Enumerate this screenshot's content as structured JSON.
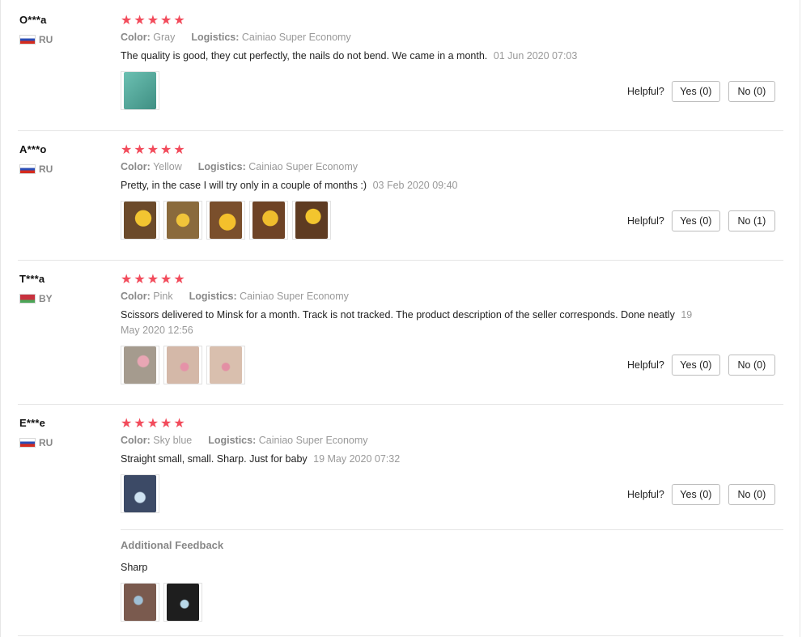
{
  "reviews": [
    {
      "user": "O***a",
      "country": "RU",
      "flag": "ru",
      "color_label": "Color:",
      "color_value": "Gray",
      "logistics_label": "Logistics:",
      "logistics_value": "Cainiao Super Economy",
      "text": "The quality is good, they cut perfectly, the nails do not bend. We came in a month.",
      "date": "01 Jun 2020 07:03",
      "helpful_label": "Helpful?",
      "yes_label": "Yes (0)",
      "no_label": "No (0)",
      "photos": [
        "#4fa79b"
      ]
    },
    {
      "user": "A***o",
      "country": "RU",
      "flag": "ru",
      "color_label": "Color:",
      "color_value": "Yellow",
      "logistics_label": "Logistics:",
      "logistics_value": "Cainiao Super Economy",
      "text": "Pretty, in the case I will try only in a couple of months :)",
      "date": "03 Feb 2020 09:40",
      "helpful_label": "Helpful?",
      "yes_label": "Yes (0)",
      "no_label": "No (1)",
      "photos": [
        "#6b4a2a",
        "#8a6a3c",
        "#7a4f2c",
        "#6e4326",
        "#5e3b22"
      ]
    },
    {
      "user": "T***a",
      "country": "BY",
      "flag": "by",
      "color_label": "Color:",
      "color_value": "Pink",
      "logistics_label": "Logistics:",
      "logistics_value": "Cainiao Super Economy",
      "text": "Scissors delivered to Minsk for a month. Track is not tracked. The product description of the seller corresponds. Done neatly",
      "date": "19 May 2020 12:56",
      "helpful_label": "Helpful?",
      "yes_label": "Yes (0)",
      "no_label": "No (0)",
      "photos": [
        "#a59b8e",
        "#d4b8a8",
        "#d9bfae"
      ]
    },
    {
      "user": "E***e",
      "country": "RU",
      "flag": "ru",
      "color_label": "Color:",
      "color_value": "Sky blue",
      "logistics_label": "Logistics:",
      "logistics_value": "Cainiao Super Economy",
      "text": "Straight small, small. Sharp. Just for baby",
      "date": "19 May 2020 07:32",
      "helpful_label": "Helpful?",
      "yes_label": "Yes (0)",
      "no_label": "No (0)",
      "photos": [
        "#3c4a66"
      ]
    }
  ],
  "additional_feedback": {
    "title": "Additional Feedback",
    "text": "Sharp",
    "photos": [
      "#7a5a4e",
      "#1e1e1e"
    ]
  },
  "colors": {
    "star": "#f24b5b",
    "muted_text": "#999999",
    "border": "#e5e5e5"
  },
  "icons": {
    "star": "star-icon",
    "flag": "flag-icon"
  }
}
